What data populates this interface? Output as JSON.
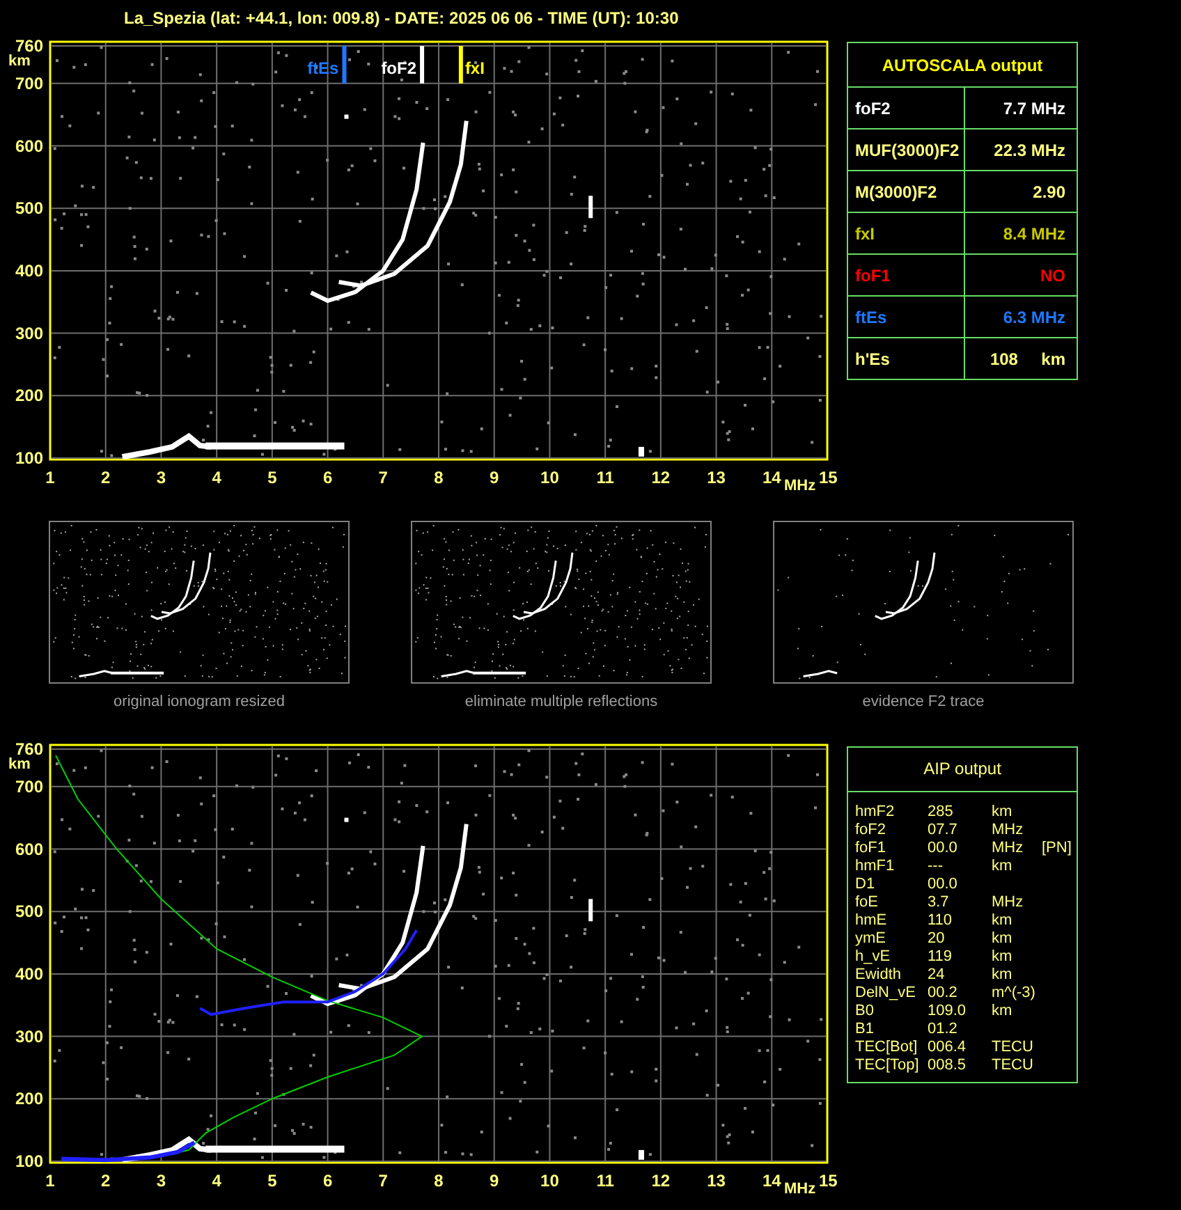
{
  "title": "La_Spezia (lat: +44.1, lon: 009.8) - DATE: 2025 06 06 - TIME (UT): 10:30",
  "plots": [
    {
      "kind": "autoscala",
      "y_unit": "km",
      "x_unit": "MHz",
      "y_ticks": [
        "760",
        "700",
        "600",
        "500",
        "400",
        "300",
        "200",
        "100"
      ],
      "x_ticks": [
        "1",
        "2",
        "3",
        "4",
        "5",
        "6",
        "7",
        "8",
        "9",
        "10",
        "11",
        "12",
        "13",
        "14",
        "15"
      ],
      "markers": [
        {
          "label": "ftEs",
          "color": "#1e78ff"
        },
        {
          "label": "foF2",
          "color": "#ffffff"
        },
        {
          "label": "fxI",
          "color": "#ffff00"
        }
      ]
    },
    {
      "kind": "profile",
      "y_unit": "km",
      "x_unit": "MHz",
      "y_ticks": [
        "760",
        "700",
        "600",
        "500",
        "400",
        "300",
        "200",
        "100"
      ],
      "x_ticks": [
        "1",
        "2",
        "3",
        "4",
        "5",
        "6",
        "7",
        "8",
        "9",
        "10",
        "11",
        "12",
        "13",
        "14",
        "15"
      ]
    }
  ],
  "autoscala": {
    "title": "AUTOSCALA output",
    "rows": [
      {
        "name": "foF2",
        "value": "7.7 MHz",
        "color": "#ffffff"
      },
      {
        "name": "MUF(3000)F2",
        "value": "22.3 MHz",
        "color": "#ffff80"
      },
      {
        "name": "M(3000)F2",
        "value": "2.90",
        "color": "#ffff80"
      },
      {
        "name": "fxI",
        "value": "8.4 MHz",
        "color": "#c8c800"
      },
      {
        "name": "foF1",
        "value": "NO",
        "color": "#ff0000"
      },
      {
        "name": "ftEs",
        "value": "6.3 MHz",
        "color": "#1e78ff"
      },
      {
        "name": "h'Es",
        "value": "108     km",
        "color": "#ffff80"
      }
    ]
  },
  "thumbnails": [
    {
      "caption": "original ionogram resized",
      "kind": "original"
    },
    {
      "caption": "eliminate multiple reflections",
      "kind": "original"
    },
    {
      "caption": "evidence F2 trace",
      "kind": "f2"
    }
  ],
  "aip": {
    "title": "AIP output",
    "rows": [
      {
        "name": "hmF2",
        "value": "285",
        "unit": "km"
      },
      {
        "name": "foF2",
        "value": "07.7",
        "unit": "MHz"
      },
      {
        "name": "foF1",
        "value": "00.0",
        "unit": "MHz",
        "note": "[PN]"
      },
      {
        "name": "hmF1",
        "value": "---",
        "unit": "km"
      },
      {
        "name": "D1",
        "value": "00.0"
      },
      {
        "name": "foE",
        "value": "3.7",
        "unit": "MHz"
      },
      {
        "name": "hmE",
        "value": "110",
        "unit": "km"
      },
      {
        "name": "ymE",
        "value": "20",
        "unit": "km"
      },
      {
        "name": "h_vE",
        "value": "119",
        "unit": "km"
      },
      {
        "name": "Ewidth",
        "value": "24",
        "unit": "km"
      },
      {
        "name": "DelN_vE",
        "value": "00.2",
        "unit": "m^(-3)"
      },
      {
        "name": "B0",
        "value": "109.0",
        "unit": "km"
      },
      {
        "name": "B1",
        "value": "01.2"
      },
      {
        "name": "TEC[Bot]",
        "value": "006.4",
        "unit": "TECU"
      },
      {
        "name": "TEC[Top]",
        "value": "008.5",
        "unit": "TECU"
      }
    ]
  }
}
